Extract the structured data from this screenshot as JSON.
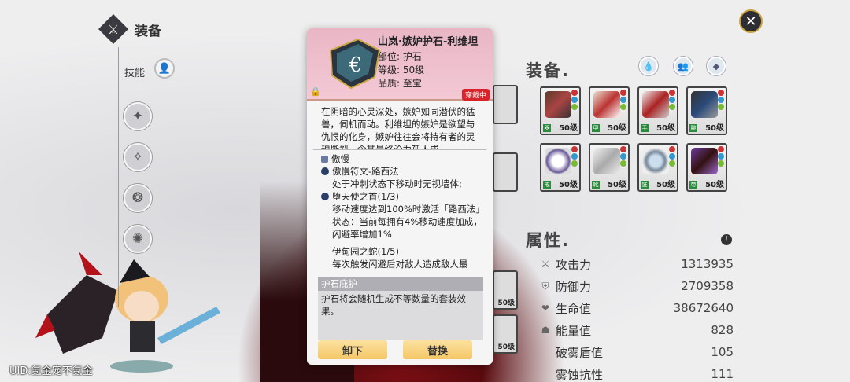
{
  "header": {
    "title": "装备",
    "title_icon": "equipment-emblem-icon"
  },
  "left_nav": {
    "skill_label": "技能"
  },
  "uid": "UID:氪金宠不氪金",
  "equipment_section": {
    "title": "装备.",
    "level_label": "50级"
  },
  "attributes_section": {
    "title": "属性.",
    "rows": [
      {
        "name": "攻击力",
        "value": "1313935"
      },
      {
        "name": "防御力",
        "value": "2709358"
      },
      {
        "name": "生命值",
        "value": "38672640"
      },
      {
        "name": "能量值",
        "value": "828"
      },
      {
        "name": "破雾盾值",
        "value": "105"
      },
      {
        "name": "雾蚀抗性",
        "value": "111"
      }
    ]
  },
  "popup": {
    "name": "山岚·嫉妒护石-利维坦",
    "slot": "部位: 护石",
    "level": "等级: 50级",
    "quality": "品质: 至宝",
    "worn_badge": "穿戴中",
    "description": "在阴暗的心灵深处，嫉妒如同潜伏的猛兽，伺机而动。利维坦的嫉妒是欲望与仇恨的化身，嫉妒往往会将持有者的灵魂撕裂，令其最终沦为孤人成",
    "set": {
      "name": "傲慢",
      "rune_name": "傲慢符文-路西法",
      "rune_effect": "处于冲刺状态下移动时无视墙体;",
      "piece1_name": "堕天使之首(1/3)",
      "piece1_effect": "移动速度达到100%时激活「路西法」状态：当前每拥有4%移动速度加成，闪避率增加1%",
      "piece2_name": "伊甸园之蛇(1/5)",
      "piece2_effect": "每次触发闪避后对敌人造成敌人最"
    },
    "protect_title": "护石庇护",
    "protect_text": "护石将会随机生成不等数量的套装效果。",
    "unequip_label": "卸下",
    "replace_label": "替换"
  }
}
